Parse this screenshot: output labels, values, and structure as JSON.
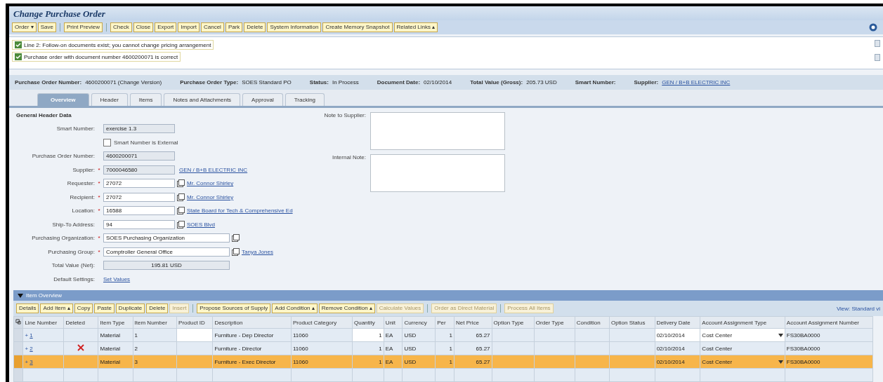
{
  "window": {
    "title": "Change Purchase Order"
  },
  "toolbar": [
    [
      {
        "label": "Order ▾",
        "disabled": false
      },
      {
        "label": "Save",
        "disabled": false
      }
    ],
    [
      {
        "label": "Print Preview",
        "disabled": false
      }
    ],
    [
      {
        "label": "Check",
        "disabled": false
      },
      {
        "label": "Close",
        "disabled": false
      },
      {
        "label": "Export",
        "disabled": false
      },
      {
        "label": "Import",
        "disabled": false
      },
      {
        "label": "Cancel",
        "disabled": false
      },
      {
        "label": "Park",
        "disabled": false
      },
      {
        "label": "Delete",
        "disabled": false
      },
      {
        "label": "System Information",
        "disabled": false
      },
      {
        "label": "Create Memory Snapshot",
        "disabled": false
      },
      {
        "label": "Related Links ▴",
        "disabled": false
      }
    ]
  ],
  "messages": [
    {
      "text": "Line 2: Follow-on documents exist; you cannot change pricing arrangement"
    },
    {
      "text": "Purchase order with document number 4600200071 is correct"
    }
  ],
  "header_info": [
    {
      "label": "Purchase Order Number:",
      "value": "4600200071 (Change Version)",
      "kind": "text"
    },
    {
      "label": "Purchase Order Type:",
      "value": "SOES Standard PO",
      "kind": "text"
    },
    {
      "label": "Status:",
      "value": "In Process",
      "kind": "text"
    },
    {
      "label": "Document Date:",
      "value": "02/10/2014",
      "kind": "text"
    },
    {
      "label": "Total Value (Gross):",
      "value": "205.73 USD",
      "kind": "text"
    },
    {
      "label": "Smart Number:",
      "kind": "label"
    },
    {
      "label": "Supplier:",
      "value": "GEN / B+B ELECTRIC INC",
      "kind": "link"
    }
  ],
  "tabs": [
    {
      "label": "Overview",
      "selected": true
    },
    {
      "label": "Header",
      "selected": false
    },
    {
      "label": "Items",
      "selected": false
    },
    {
      "label": "Notes and Attachments",
      "selected": false
    },
    {
      "label": "Approval",
      "selected": false
    },
    {
      "label": "Tracking",
      "selected": false
    }
  ],
  "form": {
    "title": "General Header Data",
    "fields": [
      {
        "label": "Smart Number:",
        "kind": "readonly",
        "value": "exercise 1.3"
      },
      {
        "kind": "checkbox",
        "label": "Smart Number is External",
        "checked": false
      },
      {
        "label": "Purchase Order Number:",
        "kind": "readonly",
        "value": "4600200071"
      },
      {
        "label": "Supplier:",
        "marker": "*",
        "kind": "readonly",
        "value": "7000046580",
        "link": "GEN / B+B ELECTRIC INC"
      },
      {
        "label": "Requester:",
        "marker": "*",
        "kind": "input",
        "value": "27072",
        "link": "Mr. Connor Shirley"
      },
      {
        "label": "Recipient:",
        "marker": "*",
        "kind": "input",
        "value": "27072",
        "link": "Mr. Connor Shirley"
      },
      {
        "label": "Location:",
        "marker": "*",
        "kind": "input",
        "value": "16588",
        "link": "State Board for Tech & Comprehensive Ed"
      },
      {
        "label": "Ship-To Address:",
        "kind": "input",
        "value": "94",
        "link": "SOES Blvd"
      },
      {
        "label": "Purchasing Organization:",
        "marker": "*",
        "kind": "wide_input",
        "value": "SOES Purchasing Organization"
      },
      {
        "label": "Purchasing Group:",
        "marker": "*",
        "kind": "wide_input",
        "value": "Comptroller General Office",
        "link": "Tanya Jones"
      },
      {
        "label": "Total Value (Net):",
        "kind": "total",
        "value": "195.81 USD"
      },
      {
        "label": "Default Settings:",
        "kind": "link",
        "link": "Set Values"
      }
    ],
    "notes": [
      {
        "label": "Note to Supplier:"
      },
      {
        "label": "Internal Note:"
      }
    ]
  },
  "items": {
    "title": "Item Overview",
    "expanded": true,
    "toolbar": [
      [
        {
          "label": "Details",
          "disabled": false
        },
        {
          "label": "Add Item ▴",
          "disabled": false
        },
        {
          "label": "Copy",
          "disabled": false
        },
        {
          "label": "Paste",
          "disabled": false
        },
        {
          "label": "Duplicate",
          "disabled": false
        },
        {
          "label": "Delete",
          "disabled": false
        },
        {
          "label": "Insert",
          "disabled": true
        }
      ],
      [
        {
          "label": "Propose Sources of Supply",
          "disabled": false
        },
        {
          "label": "Add Condition ▴",
          "disabled": false
        },
        {
          "label": "Remove Condition ▴",
          "disabled": false
        },
        {
          "label": "Calculate Values",
          "disabled": true
        }
      ],
      [
        {
          "label": "Order as Direct Material",
          "disabled": true
        }
      ],
      [
        {
          "label": "Process All Items",
          "disabled": true
        }
      ]
    ],
    "view_label": "View: Standard vi",
    "columns": [
      "Line Number",
      "Deleted",
      "Item Type",
      "Item Number",
      "Product ID",
      "Description",
      "Product Category",
      "Quantity",
      "Unit",
      "Currency",
      "Per",
      "Net Price",
      "Option Type",
      "Order Type",
      "Condition",
      "Option Status",
      "Delivery Date",
      "Account Assignment Type",
      "Account Assignment Number"
    ],
    "rows": [
      {
        "expand": "+",
        "deleted": false,
        "selected": false,
        "editable": true,
        "cells": [
          "1",
          "",
          "Material",
          "1",
          "",
          "Furniture - Dep Director",
          "11060",
          "1",
          "EA",
          "USD",
          "1",
          "65.27",
          "",
          "",
          "",
          "",
          "02/10/2014",
          "Cost Center",
          "FS30BA0000"
        ]
      },
      {
        "expand": "+",
        "deleted": true,
        "selected": false,
        "editable": false,
        "cells": [
          "2",
          "",
          "Material",
          "2",
          "",
          "Furniture - Director",
          "11060",
          "1",
          "EA",
          "USD",
          "1",
          "65.27",
          "",
          "",
          "",
          "",
          "02/10/2014",
          "Cost Center",
          "FS30BA0000"
        ]
      },
      {
        "expand": "+",
        "deleted": false,
        "selected": true,
        "editable": true,
        "cells": [
          "3",
          "",
          "Material",
          "3",
          "",
          "Furniture - Exec Director",
          "11060",
          "1",
          "EA",
          "USD",
          "1",
          "65.27",
          "",
          "",
          "",
          "",
          "02/10/2014",
          "Cost Center",
          "FS30BA0000"
        ]
      }
    ]
  }
}
